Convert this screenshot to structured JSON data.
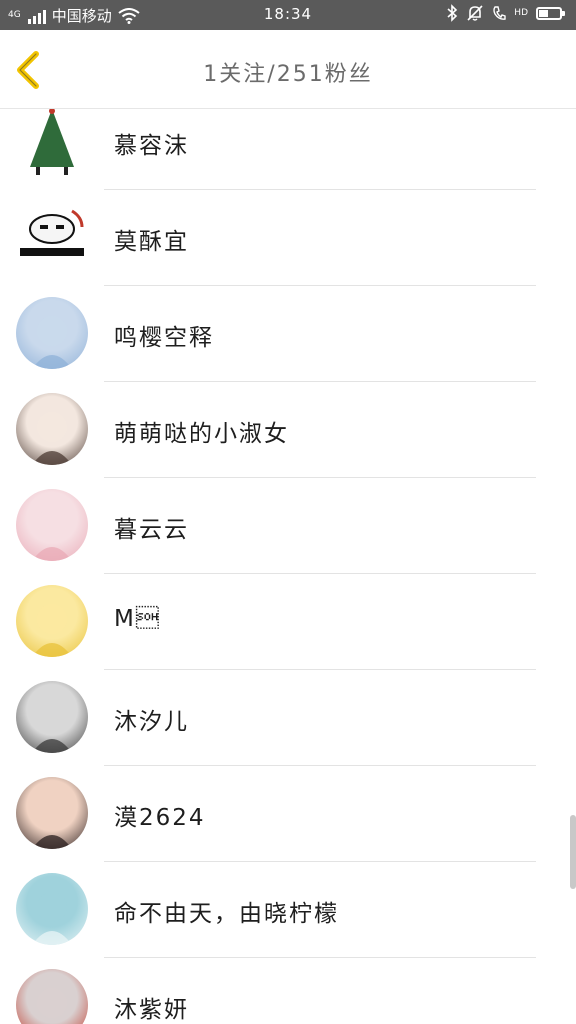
{
  "status_bar": {
    "signal_label": "4G",
    "carrier": "中国移动",
    "time": "18:34",
    "hd_label": "HD",
    "battery_level": 0.45
  },
  "header": {
    "title": "1关注/251粉丝",
    "back_icon": "chevron-left-icon",
    "back_color": "#f2c400"
  },
  "followers": [
    {
      "name": "慕容沫",
      "avatar": "christmas-tree-people-avatar",
      "colors": [
        "#ffffff",
        "#2f6b3a"
      ]
    },
    {
      "name": "莫酥宜",
      "avatar": "meme-face-avatar",
      "colors": [
        "#ffffff",
        "#111111"
      ]
    },
    {
      "name": "鸣樱空释",
      "avatar": "blue-watercolor-avatar",
      "colors": [
        "#c9d9ec",
        "#8fb1d8"
      ]
    },
    {
      "name": "萌萌哒的小淑女",
      "avatar": "anime-girl-hood-avatar",
      "colors": [
        "#f3e7df",
        "#4b3a33"
      ]
    },
    {
      "name": "暮云云",
      "avatar": "pink-anime-girl-avatar",
      "colors": [
        "#f6dfe3",
        "#e9a9b6"
      ]
    },
    {
      "name": "M\u0001",
      "avatar": "blonde-anime-avatar",
      "colors": [
        "#fbe9a0",
        "#e8c23a"
      ]
    },
    {
      "name": "沐汐儿",
      "avatar": "monochrome-girl-avatar",
      "colors": [
        "#d8d8d8",
        "#3a3a3a"
      ]
    },
    {
      "name": "漠2624",
      "avatar": "cat-ears-photo-avatar",
      "colors": [
        "#f0d2c2",
        "#2a1f1f"
      ]
    },
    {
      "name": "命不由天，由晓柠檬",
      "avatar": "dress-girl-avatar",
      "colors": [
        "#9fd2dc",
        "#e8f4f6"
      ]
    },
    {
      "name": "沐紫妍",
      "avatar": "glasses-girl-avatar",
      "colors": [
        "#d9d0d0",
        "#c0392b"
      ]
    }
  ]
}
